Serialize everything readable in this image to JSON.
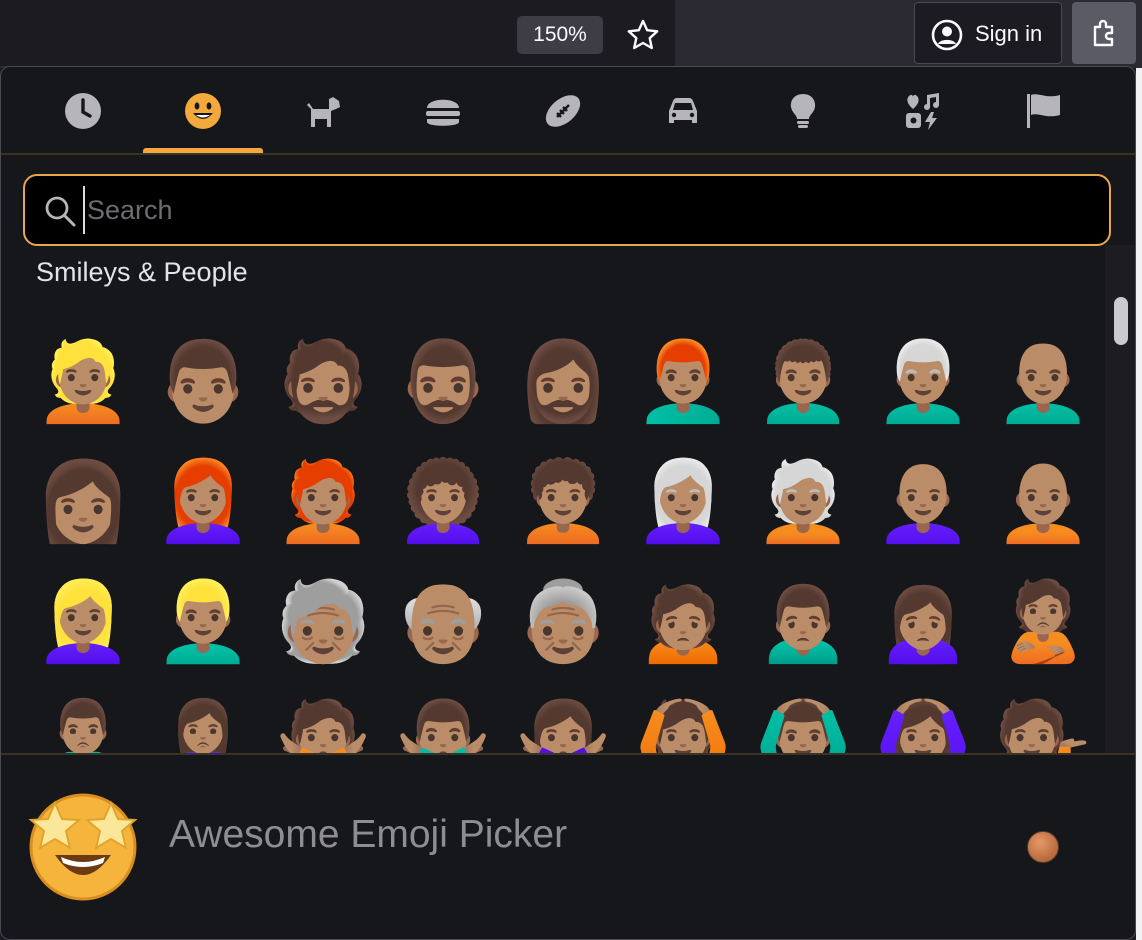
{
  "toolbar": {
    "zoom_level": "150%",
    "sign_in_label": "Sign in"
  },
  "picker": {
    "categories": [
      {
        "name": "recent",
        "icon": "clock-icon"
      },
      {
        "name": "smileys-people",
        "icon": "smiley-icon",
        "active": true
      },
      {
        "name": "animals-nature",
        "icon": "dog-icon"
      },
      {
        "name": "food-drink",
        "icon": "burger-icon"
      },
      {
        "name": "activity",
        "icon": "football-icon"
      },
      {
        "name": "travel-places",
        "icon": "car-icon"
      },
      {
        "name": "objects",
        "icon": "lightbulb-icon"
      },
      {
        "name": "symbols",
        "icon": "symbols-icon"
      },
      {
        "name": "flags",
        "icon": "flag-icon"
      }
    ],
    "search_placeholder": "Search",
    "section_title": "Smileys & People",
    "emoji_rows": [
      [
        "👱🏽",
        "👨🏽",
        "🧔🏽",
        "🧔🏽‍♂️",
        "🧔🏽‍♀️",
        "👨🏽‍🦰",
        "👨🏽‍🦱",
        "👨🏽‍🦳",
        "👨🏽‍🦲"
      ],
      [
        "👩🏽",
        "👩🏽‍🦰",
        "🧑🏽‍🦰",
        "👩🏽‍🦱",
        "🧑🏽‍🦱",
        "👩🏽‍🦳",
        "🧑🏽‍🦳",
        "👩🏽‍🦲",
        "🧑🏽‍🦲"
      ],
      [
        "👱🏽‍♀️",
        "👱🏽‍♂️",
        "🧓🏽",
        "👴🏽",
        "👵🏽",
        "🙍🏽",
        "🙍🏽‍♂️",
        "🙍🏽‍♀️",
        "🙎🏽"
      ],
      [
        "🙎🏽‍♂️",
        "🙎🏽‍♀️",
        "🙅🏽",
        "🙅🏽‍♂️",
        "🙅🏽‍♀️",
        "🙆🏽",
        "🙆🏽‍♂️",
        "🙆🏽‍♀️",
        "💁🏽"
      ]
    ],
    "footer_title": "Awesome Emoji Picker",
    "footer_logo": "star-struck-icon",
    "skin_tone_color": "#c67c4e",
    "accent_color": "#f3a93c"
  }
}
